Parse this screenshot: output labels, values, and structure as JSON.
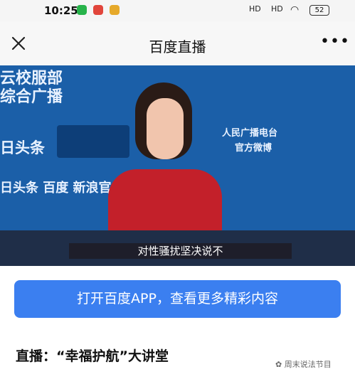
{
  "status": {
    "time": "10:25",
    "battery": "52",
    "signal": "HD",
    "signal2": "HD"
  },
  "header": {
    "title": "百度直播"
  },
  "video": {
    "bg_left_top": "云校服部",
    "bg_left_mid": "综合广播",
    "bg_toutiao": "日头条",
    "bg_bottom": "日头条 百度 新浪官",
    "bg_right": "人民广播电台",
    "bg_right2": "官方微博",
    "subtitle": "对性骚扰坚决说不"
  },
  "cta": {
    "label": "打开百度APP，查看更多精彩内容"
  },
  "live": {
    "title": "直播：“幸福护航”大讲堂"
  },
  "watermark": "周末说法节目",
  "colors": {
    "accent": "#3b7ff0",
    "video_bg": "#1b5fa8"
  }
}
